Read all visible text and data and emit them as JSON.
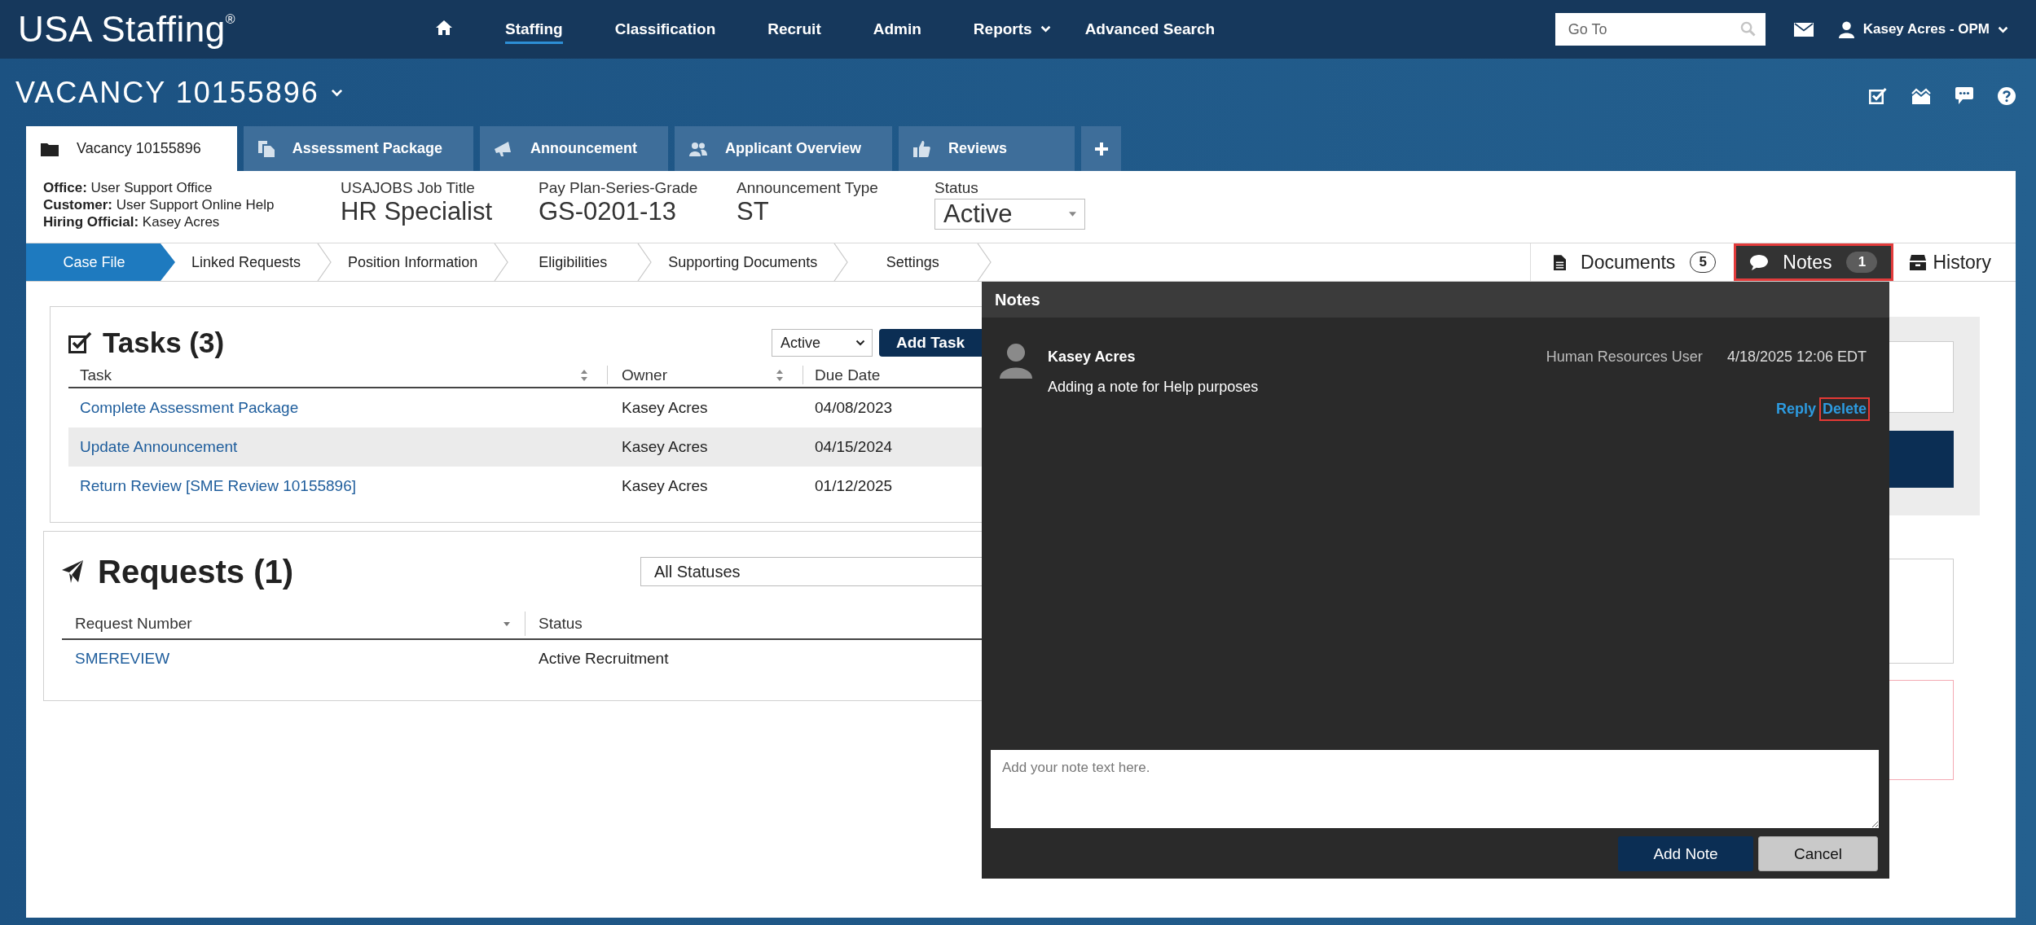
{
  "header": {
    "logo": "USA Staffing$^{®}$",
    "nav": [
      {
        "kind": "home",
        "selected": false
      },
      {
        "kind": "link",
        "label": "Staffing",
        "selected": true
      },
      {
        "kind": "link",
        "label": "Classification",
        "selected": false
      },
      {
        "kind": "link",
        "label": "Recruit",
        "selected": false
      },
      {
        "kind": "link",
        "label": "Admin",
        "selected": false
      },
      {
        "kind": "menu",
        "label": "Reports",
        "selected": false
      },
      {
        "kind": "link",
        "label": "Advanced Search",
        "selected": false
      }
    ],
    "search": {
      "placeholder": "Go To"
    },
    "user": "Kasey Acres - OPM"
  },
  "vacancy": {
    "title": "VACANCY 10155896"
  },
  "record_tabs": [
    {
      "kind": "vacancy",
      "label": "Vacancy 10155896",
      "selected": true
    },
    {
      "kind": "assessment",
      "label": "Assessment Package",
      "selected": false
    },
    {
      "kind": "announcement",
      "label": "Announcement",
      "selected": false
    },
    {
      "kind": "applicants",
      "label": "Applicant Overview",
      "selected": false
    },
    {
      "kind": "reviews",
      "label": "Reviews",
      "selected": false
    },
    {
      "kind": "add",
      "selected": false
    }
  ],
  "summary": {
    "lines": [
      "**Office:** User Support Office",
      "**Customer:** User Support Online Help",
      "**Hiring Official:** Kasey Acres"
    ],
    "fields": [
      {
        "label": "USAJOBS Job Title",
        "value": "HR Specialist"
      },
      {
        "label": "Pay Plan-Series-Grade",
        "value": "GS-0201-13"
      },
      {
        "label": "Announcement Type",
        "value": "ST"
      }
    ],
    "status": {
      "label": "Status",
      "value": "Active"
    }
  },
  "steps": [
    {
      "label": "Case File",
      "selected": true
    },
    {
      "label": "Linked Requests",
      "selected": false
    },
    {
      "label": "Position Information",
      "selected": false
    },
    {
      "label": "Eligibilities",
      "selected": false
    },
    {
      "label": "Supporting Documents",
      "selected": false
    },
    {
      "label": "Settings",
      "selected": false
    }
  ],
  "panels": [
    {
      "kind": "documents",
      "label": "Documents",
      "count": "5",
      "selected": false,
      "highlighted": false
    },
    {
      "kind": "notes",
      "label": "Notes",
      "count": "1",
      "selected": true,
      "highlighted": true
    },
    {
      "kind": "history",
      "label": "History",
      "selected": false,
      "highlighted": false
    }
  ],
  "tasks": {
    "title": "Tasks (3)",
    "filter": "Active",
    "add_button": "Add Task",
    "columns": [
      {
        "label": "Task",
        "sortable": true
      },
      {
        "label": "Owner",
        "sortable": true
      },
      {
        "label": "Due Date",
        "sortable": false
      }
    ],
    "rows": [
      {
        "task": "Complete Assessment Package",
        "owner": "Kasey Acres",
        "due_date": "04/08/2023"
      },
      {
        "task": "Update Announcement",
        "owner": "Kasey Acres",
        "due_date": "04/15/2024"
      },
      {
        "task": "Return Review [SME Review 10155896]",
        "owner": "Kasey Acres",
        "due_date": "01/12/2025"
      }
    ]
  },
  "requests": {
    "title": "Requests (1)",
    "filter": "All Statuses",
    "columns": [
      {
        "label": "Request Number",
        "sorted": true
      },
      {
        "label": "Status",
        "sorted": false
      }
    ],
    "rows": [
      {
        "request_number": "SMEREVIEW",
        "status": "Active Recruitment"
      }
    ]
  },
  "notes_panel": {
    "title": "Notes",
    "notes": [
      {
        "author": "Kasey Acres",
        "role": "Human Resources User",
        "date": "4/18/2025 12:06 EDT",
        "text": "Adding a note for Help purposes",
        "actions": [
          {
            "label": "Reply",
            "highlighted": false
          },
          {
            "label": "Delete",
            "highlighted": true
          }
        ]
      }
    ],
    "input": {
      "placeholder": "Add your note text here."
    },
    "buttons": [
      {
        "label": "Add Note",
        "kind": "primary"
      },
      {
        "label": "Cancel",
        "kind": "secondary"
      }
    ]
  }
}
